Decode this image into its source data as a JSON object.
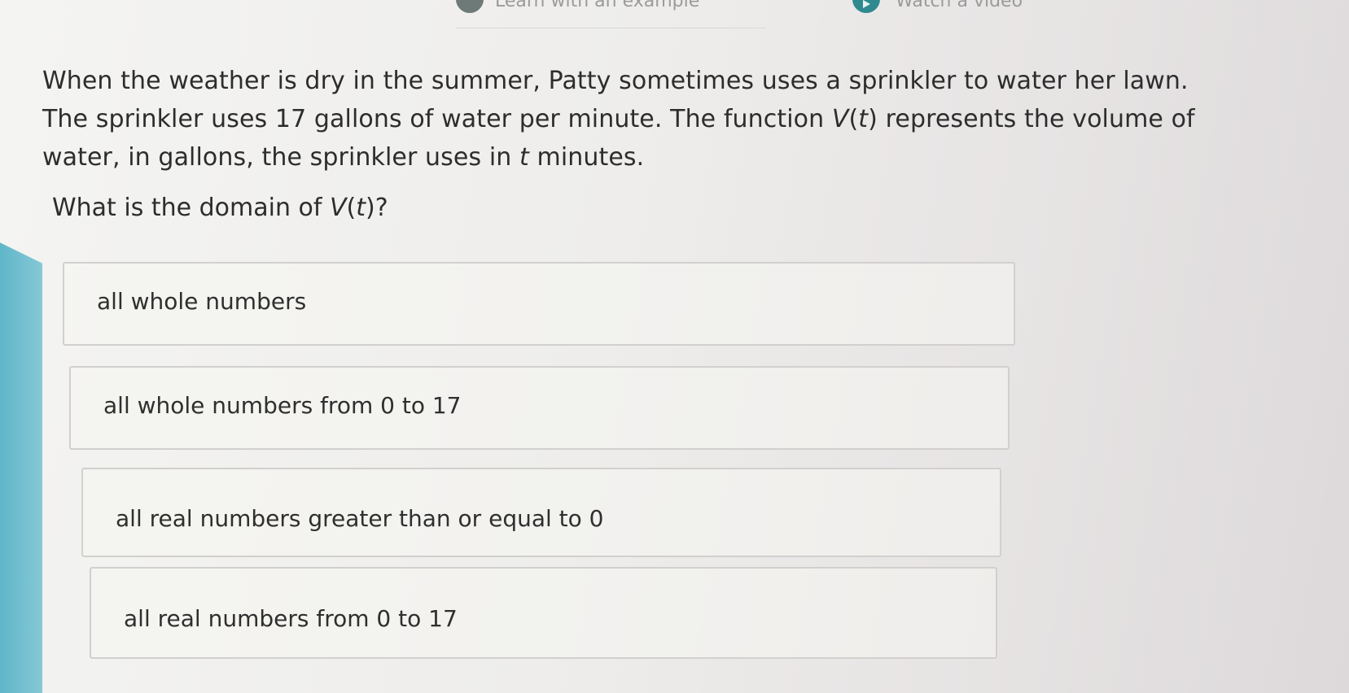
{
  "header": {
    "example_link": "Learn with an example",
    "video_link": "Watch a video"
  },
  "question": {
    "line1": "When the weather is dry in the summer, Patty sometimes uses a sprinkler to water her lawn.",
    "line2_a": "The sprinkler uses 17 gallons of water per minute. The function ",
    "line2_fn": "V",
    "line2_open": "(",
    "line2_var": "t",
    "line2_b": ") represents the volume of",
    "line3_a": "water, in gallons, the sprinkler uses in ",
    "line3_var": "t",
    "line3_b": " minutes.",
    "prompt_a": "What is the domain of ",
    "prompt_fn": "V",
    "prompt_open": "(",
    "prompt_var": "t",
    "prompt_b": ")?"
  },
  "choices": [
    {
      "label": "all whole numbers"
    },
    {
      "label": "all whole numbers from 0 to 17"
    },
    {
      "label": "all real numbers greater than or equal to 0"
    },
    {
      "label": "all real numbers from 0 to 17"
    }
  ]
}
